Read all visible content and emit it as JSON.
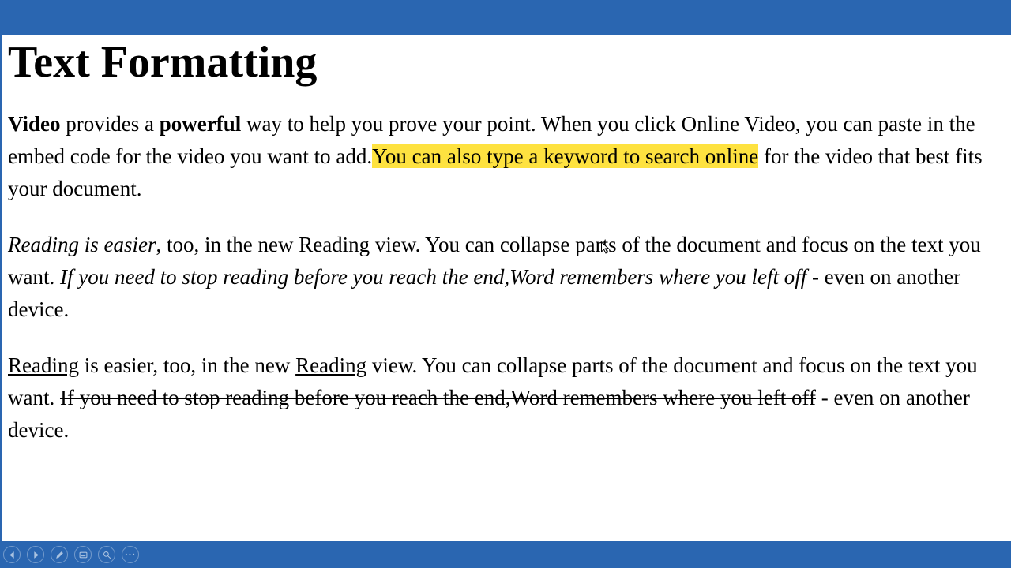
{
  "title": "Text Formatting",
  "p1": {
    "r1": "Video",
    "r2": " provides a ",
    "r3": "powerful",
    "r4": " way to help you prove your point. When you click Online Video, you can paste in the embed code for the video you want to add.",
    "r5_hl": "You can also type a keyword to search online",
    "r6": " for the video that best fits your document."
  },
  "p2": {
    "r1_i": "Reading is easier",
    "r2": ", too, in the new Reading view. You can collapse parts of the document and focus on the text you want. ",
    "r3_i": "If you need to stop reading before you reach the end,Word remembers where you left off",
    "r4": " - even on another device."
  },
  "p3": {
    "r1_u": "Reading",
    "r2": " is easier, too, in the new ",
    "r3_u": "Reading",
    "r4": " view. You can collapse parts of the document and focus on the text you want. ",
    "r5_s": "If you need to stop reading before you reach the end,Word remembers where you left off",
    "r6": " - even on another device."
  },
  "toolbar": {
    "prev": "prev-slide-button",
    "next": "next-slide-button",
    "pen": "pen-tool-button",
    "subtitles": "subtitles-button",
    "zoom": "zoom-button",
    "more": "more-options-button",
    "more_label": "···"
  }
}
